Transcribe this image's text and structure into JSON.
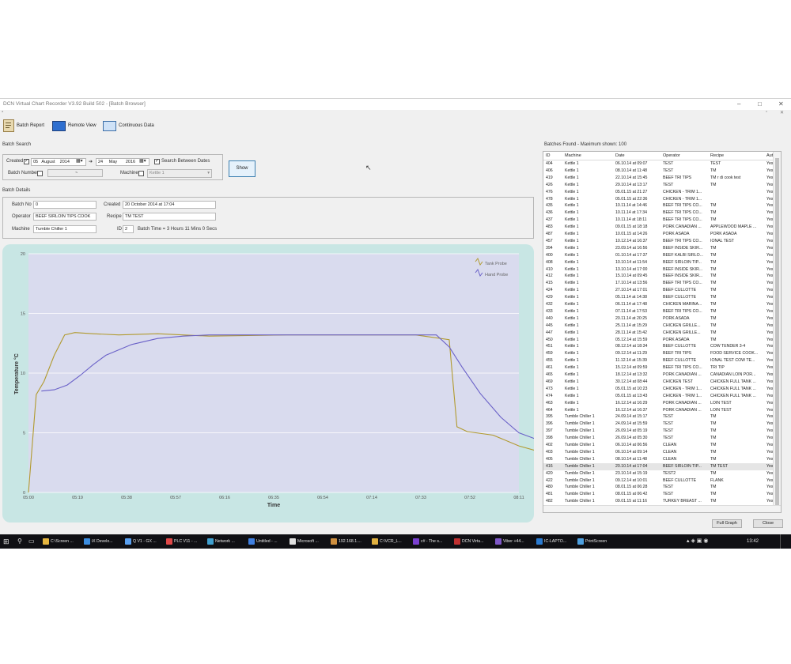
{
  "window": {
    "title": "DCN Virtual Chart Recorder V3.92 Build 502 - [Batch Browser]",
    "controls": [
      "–",
      "□",
      "✕"
    ]
  },
  "toolbar": {
    "batch_report": "Batch Report",
    "remote_view": "Remote View",
    "continuous_data": "Continuous Data"
  },
  "search": {
    "section": "Batch Search",
    "created_label": "Created",
    "from_day": "05",
    "from_month": "August",
    "from_year": "2014",
    "to_day": "24",
    "to_month": "May",
    "to_year": "2016",
    "between_label": "Search Between Dates",
    "batch_number_label": "Batch Number",
    "machine_label": "Machine",
    "machine_value": "Kettle 1",
    "show_button": "Show"
  },
  "details": {
    "section": "Batch Details",
    "batch_no_label": "Batch No",
    "batch_no": "0",
    "created_label": "Created",
    "created": "20 October 2014 at 17:04",
    "operator_label": "Operator",
    "operator": "BEEF SIRLOIN TIPS COOK",
    "recipe_label": "Recipe",
    "recipe": "TM TEST",
    "machine_label": "Machine",
    "machine": "Tumble Chiller 1",
    "id_label": "ID",
    "id": "2",
    "batch_time": "Batch Time = 3 Hours 11 Mins 0 Secs"
  },
  "chart_data": {
    "type": "line",
    "xlabel": "Time",
    "ylabel": "Temperature °C",
    "x_ticks": [
      "05:00",
      "05:19",
      "05:38",
      "05:57",
      "06:16",
      "06:35",
      "06:54",
      "07:14",
      "07:33",
      "07:52",
      "08:11"
    ],
    "y_ticks": [
      0,
      5,
      10,
      15,
      20
    ],
    "ylim": [
      0,
      20
    ],
    "x_unit": "minutes after 05:00",
    "grid": true,
    "legend_position": "top-right",
    "series": [
      {
        "name": "Tank Probe",
        "color": "#b19a2e",
        "x": [
          0,
          3,
          6,
          10,
          14,
          18,
          25,
          35,
          50,
          70,
          100,
          130,
          150,
          163,
          166,
          170,
          180,
          190,
          200,
          208
        ],
        "y": [
          0,
          8.2,
          9.3,
          11.5,
          13.2,
          13.4,
          13.3,
          13.2,
          13.3,
          13.1,
          13.2,
          13.2,
          13.2,
          12.8,
          5.5,
          5.1,
          4.8,
          3.9,
          3.3,
          3.2
        ]
      },
      {
        "name": "Hand Probe",
        "color": "#6a61c8",
        "x": [
          5,
          10,
          15,
          20,
          25,
          30,
          40,
          50,
          60,
          70,
          80,
          90,
          100,
          120,
          150,
          158,
          163,
          168,
          175,
          183,
          190,
          200,
          208
        ],
        "y": [
          8.5,
          8.6,
          9.0,
          9.8,
          10.7,
          11.5,
          12.4,
          12.9,
          13.1,
          13.2,
          13.2,
          13.2,
          13.2,
          13.2,
          13.2,
          13.2,
          12.2,
          10.5,
          8.3,
          6.3,
          5.0,
          4.2,
          3.8
        ]
      }
    ]
  },
  "batches": {
    "header": "Batches Found - Maximum shown: 100",
    "columns": [
      "ID",
      "Machine",
      "Date",
      "Operator",
      "Recipe",
      "Auto"
    ],
    "rows": [
      [
        "404",
        "Kettle 1",
        "06.10.14 at 09:07",
        "TEST",
        "TEST",
        "Yes"
      ],
      [
        "406",
        "Kettle 1",
        "08.10.14 at 11:48",
        "TEST",
        "TM",
        "Yes"
      ],
      [
        "419",
        "Kettle 1",
        "22.10.14 at 15:45",
        "BEEF TRI TIPS",
        "TM r di cook test",
        "Yes"
      ],
      [
        "426",
        "Kettle 1",
        "29.10.14 at 13:17",
        "TEST",
        "TM",
        "Yes"
      ],
      [
        "476",
        "Kettle 1",
        "05.01.15 at 21:27",
        "CHICKEN - TRIM 1...",
        "",
        "Yes"
      ],
      [
        "478",
        "Kettle 1",
        "05.01.15 at 22:36",
        "CHICKEN - TRIM 1...",
        "",
        "Yes"
      ],
      [
        "435",
        "Kettle 1",
        "10.11.14 at 14:46",
        "BEEF TRI TIPS CO...",
        "TM",
        "Yes"
      ],
      [
        "436",
        "Kettle 1",
        "10.11.14 at 17:34",
        "BEEF TRI TIPS CO...",
        "TM",
        "Yes"
      ],
      [
        "437",
        "Kettle 1",
        "10.11.14 at 18:11",
        "BEEF TRI TIPS CO...",
        "TM",
        "Yes"
      ],
      [
        "483",
        "Kettle 1",
        "09.01.15 at 18:18",
        "PORK CANADIAN ...",
        "APPLEWOOD MAPLE ...",
        "Yes"
      ],
      [
        "487",
        "Kettle 1",
        "10.01.15 at 14:26",
        "PORK ASADA",
        "PORK ASADA",
        "Yes"
      ],
      [
        "457",
        "Kettle 1",
        "10.12.14 at 16:37",
        "BEEF TRI TIPS CO...",
        "IONAL TEST",
        "Yes"
      ],
      [
        "394",
        "Kettle 1",
        "23.09.14 at 16:56",
        "BEEF INSIDE SKIR...",
        "TM",
        "Yes"
      ],
      [
        "400",
        "Kettle 1",
        "01.10.14 at 17:37",
        "BEEF KALBI SIRLO...",
        "TM",
        "Yes"
      ],
      [
        "408",
        "Kettle 1",
        "10.10.14 at 11:54",
        "BEEF SIRLOIN TIP...",
        "TM",
        "Yes"
      ],
      [
        "410",
        "Kettle 1",
        "13.10.14 at 17:00",
        "BEEF INSIDE SKIR...",
        "TM",
        "Yes"
      ],
      [
        "412",
        "Kettle 1",
        "15.10.14 at 09:45",
        "BEEF INSIDE SKIR...",
        "TM",
        "Yes"
      ],
      [
        "415",
        "Kettle 1",
        "17.10.14 at 13:56",
        "BEEF TRI TIPS CO...",
        "TM",
        "Yes"
      ],
      [
        "424",
        "Kettle 1",
        "27.10.14 at 17:01",
        "BEEF CULLOTTE",
        "TM",
        "Yes"
      ],
      [
        "429",
        "Kettle 1",
        "05.11.14 at 14:38",
        "BEEF CULLOTTE",
        "TM",
        "Yes"
      ],
      [
        "432",
        "Kettle 1",
        "06.11.14 at 17:48",
        "CHICKEN MARINA...",
        "TM",
        "Yes"
      ],
      [
        "433",
        "Kettle 1",
        "07.11.14 at 17:53",
        "BEEF TRI TIPS CO...",
        "TM",
        "Yes"
      ],
      [
        "440",
        "Kettle 1",
        "20.11.14 at 20:25",
        "PORK ASADA",
        "TM",
        "Yes"
      ],
      [
        "445",
        "Kettle 1",
        "25.11.14 at 15:29",
        "CHICKEN GRILLE...",
        "TM",
        "Yes"
      ],
      [
        "447",
        "Kettle 1",
        "28.11.14 at 15:42",
        "CHICKEN GRILLE...",
        "TM",
        "Yes"
      ],
      [
        "450",
        "Kettle 1",
        "05.12.14 at 15:59",
        "PORK ASADA",
        "TM",
        "Yes"
      ],
      [
        "451",
        "Kettle 1",
        "08.12.14 at 18:34",
        "BEEF CULLOTTE",
        "COW TENDER 3-4",
        "Yes"
      ],
      [
        "459",
        "Kettle 1",
        "09.12.14 at 11:29",
        "BEEF TRI TIPS",
        "FOOD SERVICE COOK...",
        "Yes"
      ],
      [
        "455",
        "Kettle 1",
        "11.12.14 at 15:39",
        "BEEF CULLOTTE",
        "IONAL TEST COW TE...",
        "Yes"
      ],
      [
        "461",
        "Kettle 1",
        "15.12.14 at 09:59",
        "BEEF TRI TIPS CO...",
        "TRI TIP",
        "Yes"
      ],
      [
        "465",
        "Kettle 1",
        "18.12.14 at 13:32",
        "PORK CANADIAN ...",
        "CANADIAN LOIN POR...",
        "Yes"
      ],
      [
        "469",
        "Kettle 1",
        "30.12.14 at 08:44",
        "CHICKEN TEST",
        "CHICKEN FULL TANK ...",
        "Yes"
      ],
      [
        "473",
        "Kettle 1",
        "05.01.15 at 10:23",
        "CHICKEN - TRIM 1...",
        "CHICKEN FULL TANK ...",
        "Yes"
      ],
      [
        "474",
        "Kettle 1",
        "05.01.15 at 13:43",
        "CHICKEN - TRIM 1...",
        "CHICKEN FULL TANK ...",
        "Yes"
      ],
      [
        "463",
        "Kettle 1",
        "16.12.14 at 16:29",
        "PORK CANADIAN ...",
        "LOIN TEST",
        "Yes"
      ],
      [
        "464",
        "Kettle 1",
        "16.12.14 at 16:37",
        "PORK CANADIAN ...",
        "LOIN TEST",
        "Yes"
      ],
      [
        "395",
        "Tumble Chiller 1",
        "24.09.14 at 15:17",
        "TEST",
        "TM",
        "Yes"
      ],
      [
        "396",
        "Tumble Chiller 1",
        "24.09.14 at 15:59",
        "TEST",
        "TM",
        "Yes"
      ],
      [
        "397",
        "Tumble Chiller 1",
        "26.09.14 at 05:19",
        "TEST",
        "TM",
        "Yes"
      ],
      [
        "398",
        "Tumble Chiller 1",
        "26.09.14 at 05:30",
        "TEST",
        "TM",
        "Yes"
      ],
      [
        "402",
        "Tumble Chiller 1",
        "06.10.14 at 06:56",
        "CLEAN",
        "TM",
        "Yes"
      ],
      [
        "403",
        "Tumble Chiller 1",
        "06.10.14 at 09:14",
        "CLEAN",
        "TM",
        "Yes"
      ],
      [
        "405",
        "Tumble Chiller 1",
        "08.10.14 at 11:48",
        "CLEAN",
        "TM",
        "Yes"
      ],
      [
        "416",
        "Tumble Chiller 1",
        "20.10.14 at 17:04",
        "BEEF SIRLOIN TIP...",
        "TM TEST",
        "Yes"
      ],
      [
        "420",
        "Tumble Chiller 1",
        "23.10.14 at 15:19",
        "TEST2",
        "TM",
        "Yes"
      ],
      [
        "422",
        "Tumble Chiller 1",
        "09.12.14 at 10:01",
        "BEEF CULLOTTE",
        "FLANK",
        "Yes"
      ],
      [
        "480",
        "Tumble Chiller 1",
        "08.01.15 at 06:28",
        "TEST",
        "TM",
        "Yes"
      ],
      [
        "481",
        "Tumble Chiller 1",
        "08.01.15 at 06:42",
        "TEST",
        "TM",
        "Yes"
      ],
      [
        "482",
        "Tumble Chiller 1",
        "09.01.15 at 11:16",
        "TURKEY BREAST ...",
        "TM",
        "Yes"
      ]
    ]
  },
  "footer": {
    "full_graph": "Full Graph",
    "close": "Close"
  },
  "taskbar": {
    "items": [
      "C:\\Screen ...",
      "iX Develo...",
      "Q V1 - GX ...",
      "PLC V11 - ...",
      "Network ...",
      "Untitled - ...",
      "Microsoft ...",
      "192.168.1....",
      "C:\\VCR_L...",
      "c# - The s...",
      "DCN Virtu...",
      "Viber +44...",
      "IC-LAPTO...",
      "PrintScreen"
    ],
    "clock": "13:42"
  }
}
